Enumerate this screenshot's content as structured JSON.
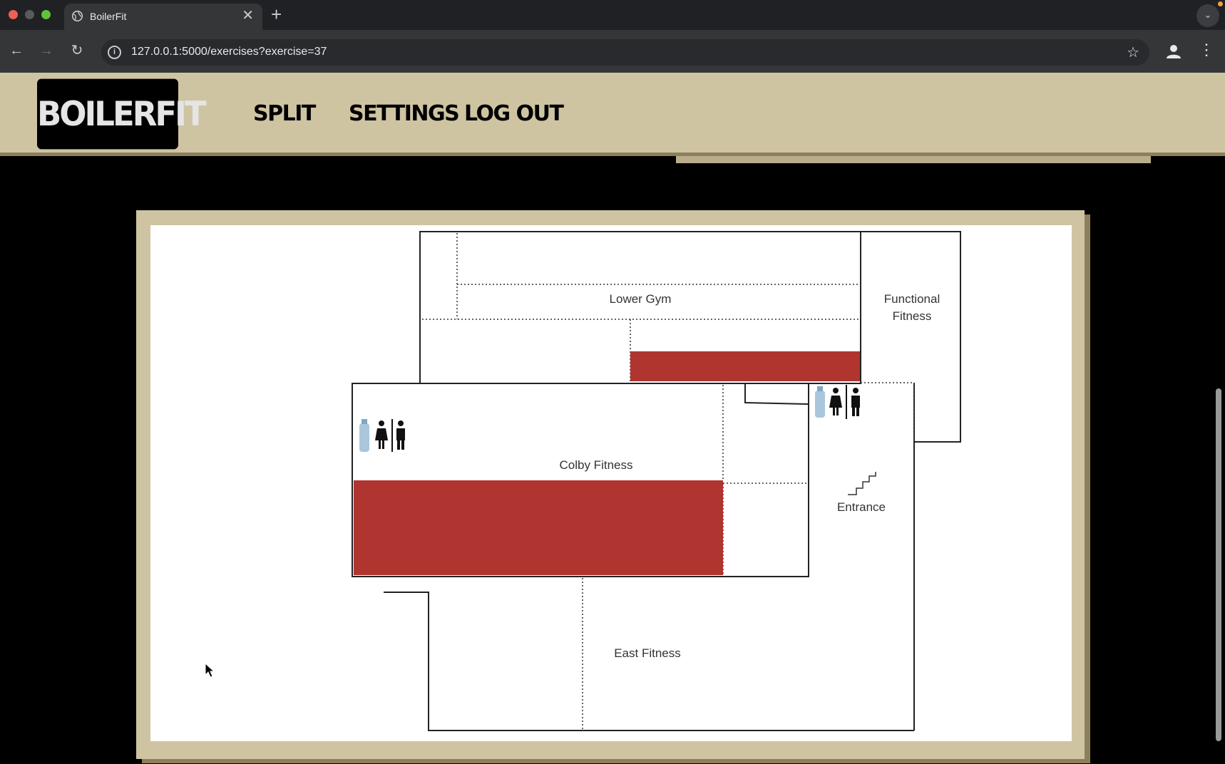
{
  "browser": {
    "tab_title": "BoilerFit",
    "tab_close": "✕",
    "new_tab": "+",
    "url": "127.0.0.1:5000/exercises?exercise=37",
    "back": "←",
    "forward": "→",
    "reload": "↻",
    "star": "☆",
    "menu": "⋮",
    "tab_menu": "⌄"
  },
  "app": {
    "logo": "BOILERFIT",
    "nav": [
      {
        "label": "SPLIT"
      },
      {
        "label": "SETTINGS"
      },
      {
        "label": "LOG OUT"
      }
    ]
  },
  "map": {
    "areas": {
      "lower_gym": "Lower Gym",
      "functional_fitness_line1": "Functional",
      "functional_fitness_line2": "Fitness",
      "colby_fitness": "Colby Fitness",
      "entrance": "Entrance",
      "east_fitness": "East Fitness"
    },
    "highlight_color": "#b03530",
    "highlighted_zones": [
      "lower-gym-strip",
      "colby-fitness-strip"
    ],
    "icons": [
      "water-bottle-icon",
      "restroom-icon",
      "stairs-icon"
    ]
  }
}
